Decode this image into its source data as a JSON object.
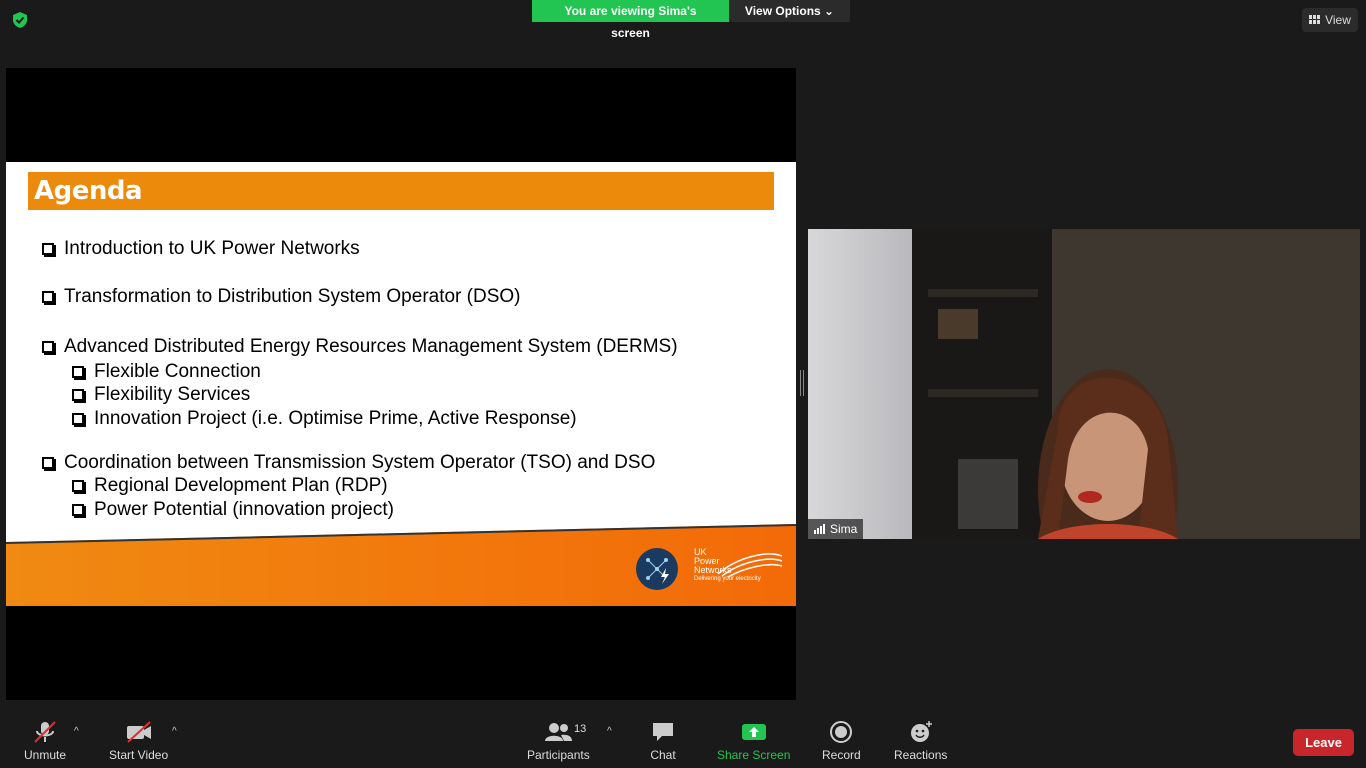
{
  "banner": {
    "viewing_text": "You are viewing Sima's screen",
    "view_options_label": "View Options ⌄"
  },
  "top_right": {
    "view_label": "View"
  },
  "slide": {
    "title": "Agenda",
    "bullets": [
      "Introduction to UK Power Networks",
      "Transformation to Distribution System Operator (DSO)",
      "Advanced Distributed Energy Resources Management System (DERMS)",
      "Flexible Connection",
      "Flexibility Services",
      "Innovation Project (i.e. Optimise Prime, Active Response)",
      "Coordination between Transmission System Operator (TSO) and DSO",
      "Regional Development Plan (RDP)",
      "Power Potential (innovation project)"
    ],
    "logo": {
      "line1": "UK",
      "line2": "Power",
      "line3": "Networks",
      "tagline": "Delivering your electricity"
    }
  },
  "participant": {
    "name": "Sima"
  },
  "toolbar": {
    "unmute": "Unmute",
    "start_video": "Start Video",
    "participants": "Participants",
    "participants_count": "13",
    "chat": "Chat",
    "share_screen": "Share Screen",
    "record": "Record",
    "reactions": "Reactions",
    "leave": "Leave"
  },
  "colors": {
    "accent_green": "#23c552",
    "slide_orange": "#ec8a0c",
    "leave_red": "#c8262b"
  }
}
